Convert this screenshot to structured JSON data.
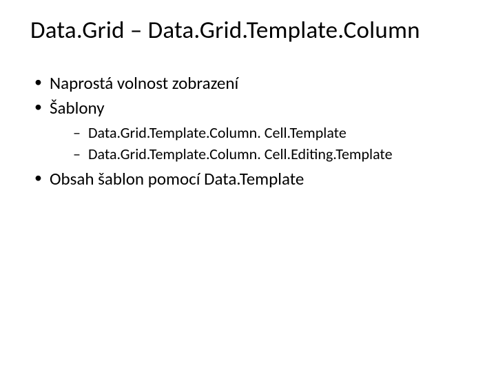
{
  "title": "Data.Grid – Data.Grid.Template.Column",
  "bullets": {
    "b1": "Naprostá volnost zobrazení",
    "b2": "Šablony",
    "b2_sub": {
      "s1": "Data.Grid.Template.Column. Cell.Template",
      "s2": "Data.Grid.Template.Column. Cell.Editing.Template"
    },
    "b3": "Obsah šablon pomocí Data.Template"
  }
}
